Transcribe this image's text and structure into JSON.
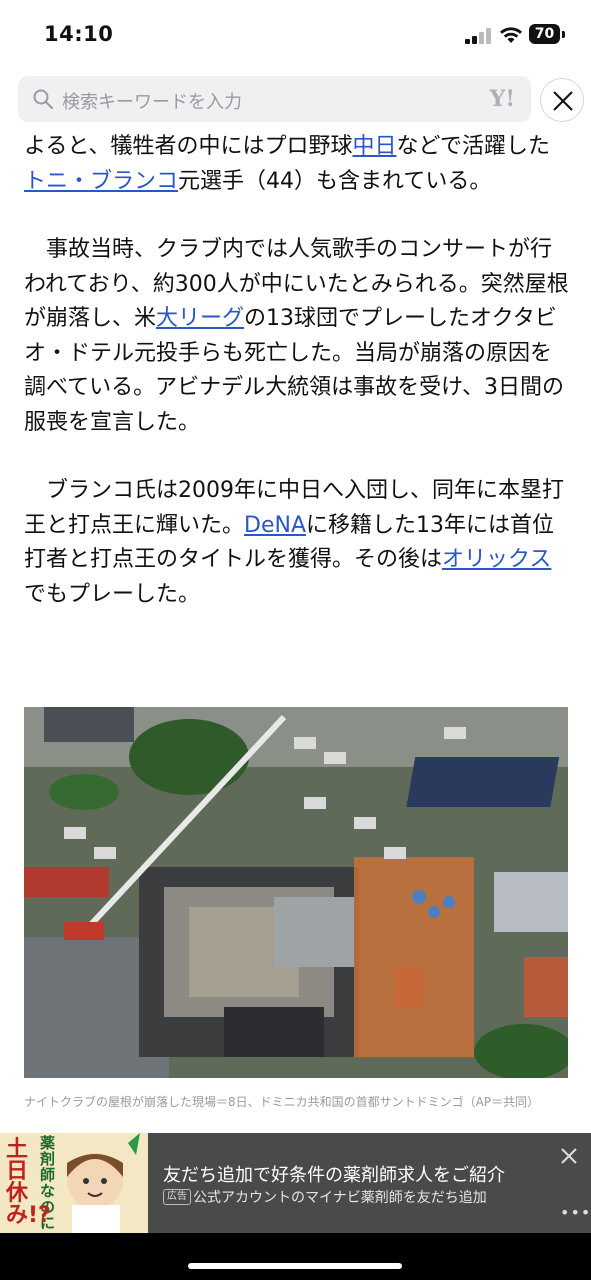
{
  "status_bar": {
    "time": "14:10",
    "battery": "70"
  },
  "search": {
    "placeholder": "検索キーワードを入力",
    "logo": "Y!"
  },
  "article": {
    "p1": {
      "t1": "よると、犠牲者の中にはプロ野球",
      "link1": "中日",
      "t2": "などで活躍した",
      "link2": "トニ・ブランコ",
      "t3": "元選手（44）も含まれている。"
    },
    "p2": {
      "t1": "事故当時、クラブ内では人気歌手のコンサートが行われており、約300人が中にいたとみられる。突然屋根が崩落し、米",
      "link1": "大リーグ",
      "t2": "の13球団でプレーしたオクタビオ・ドテル元投手らも死亡した。当局が崩落の原因を調べている。アビナデル大統領は事故を受け、3日間の服喪を宣言した。"
    },
    "p3": {
      "t1": "ブランコ氏は2009年に中日へ入団し、同年に本塁打王と打点王に輝いた。",
      "link1": "DeNA",
      "t2": "に移籍した13年には首位打者と打点王のタイトルを獲得。その後は",
      "link2": "オリックス",
      "t3": "でもプレーした。"
    }
  },
  "photo": {
    "caption": "ナイトクラブの屋根が崩落した現場＝8日、ドミニカ共和国の首都サントドミンゴ（AP＝共同）"
  },
  "ad": {
    "image_text_1": "薬剤師なのに",
    "image_text_2": "土日休み!?",
    "title": "友だち追加で好条件の薬剤師求人をご紹介",
    "badge": "広告",
    "subtitle": "公式アカウントのマイナビ薬剤師を友だち追加",
    "more": "•••"
  },
  "colors": {
    "link": "#2a56c6",
    "ad_background": "#4a4a4a"
  }
}
